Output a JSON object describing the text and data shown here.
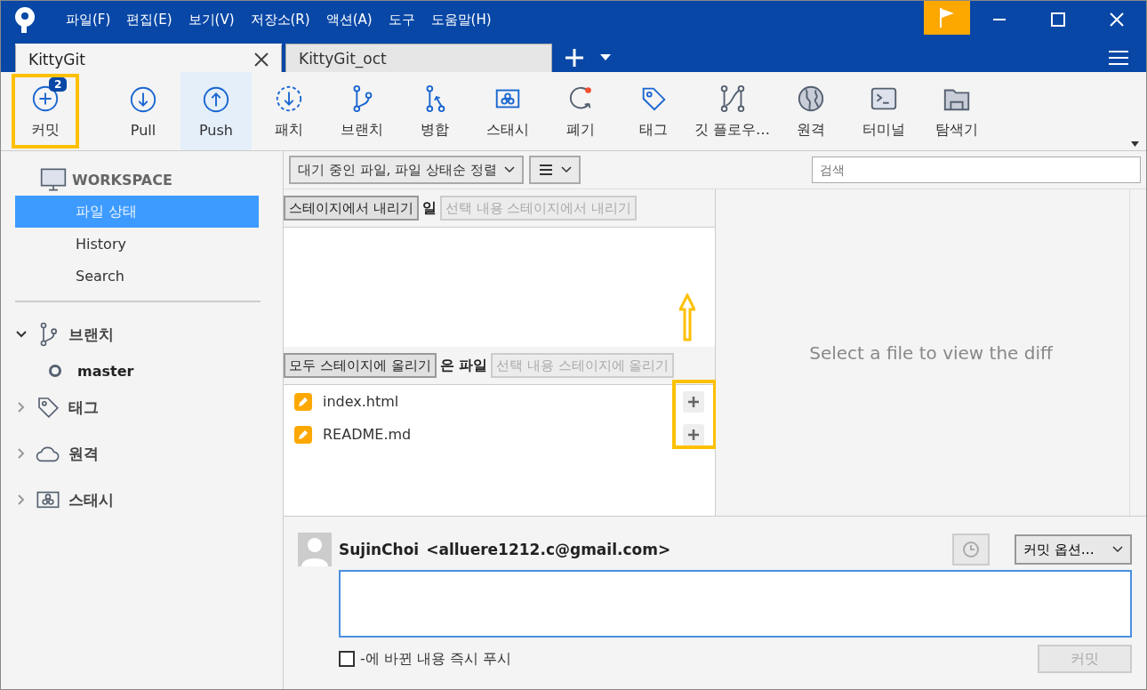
{
  "menu": [
    "파일(F)",
    "편집(E)",
    "보기(V)",
    "저장소(R)",
    "액션(A)",
    "도구",
    "도움말(H)"
  ],
  "tabs": [
    {
      "label": "KittyGit",
      "selected": true
    },
    {
      "label": "KittyGit_oct",
      "selected": false
    }
  ],
  "toolbar": [
    {
      "kind": "commit",
      "label": "커밋",
      "badge": "2",
      "selected": false,
      "highlighted": true
    },
    {
      "kind": "pull",
      "label": "Pull",
      "selected": false
    },
    {
      "kind": "push",
      "label": "Push",
      "selected": true
    },
    {
      "kind": "patch",
      "label": "패치",
      "selected": false
    },
    {
      "kind": "branch",
      "label": "브랜치",
      "selected": false
    },
    {
      "kind": "merge",
      "label": "병합",
      "selected": false
    },
    {
      "kind": "stash",
      "label": "스태시",
      "selected": false
    },
    {
      "kind": "discard",
      "label": "폐기",
      "selected": false
    },
    {
      "kind": "tag",
      "label": "태그",
      "selected": false
    },
    {
      "kind": "flow",
      "label": "깃 플로우…",
      "selected": false
    },
    {
      "kind": "remote",
      "label": "원격",
      "selected": false
    },
    {
      "kind": "terminal",
      "label": "터미널",
      "selected": false
    },
    {
      "kind": "explorer",
      "label": "탐색기",
      "selected": false
    }
  ],
  "sidebar": {
    "workspace": "WORKSPACE",
    "items": [
      {
        "label": "파일 상태",
        "selected": true
      },
      {
        "label": "History",
        "selected": false
      },
      {
        "label": "Search",
        "selected": false
      }
    ],
    "sections": [
      {
        "kind": "branch",
        "label": "브랜치",
        "expanded": true,
        "children": [
          {
            "label": "master",
            "current": true
          }
        ]
      },
      {
        "kind": "tag",
        "label": "태그",
        "expanded": false
      },
      {
        "kind": "remote",
        "label": "원격",
        "expanded": false
      },
      {
        "kind": "stash",
        "label": "스태시",
        "expanded": false
      }
    ]
  },
  "filter": {
    "sort": "대기 중인 파일, 파일 상태순 정렬",
    "search_placeholder": "검색"
  },
  "staged": {
    "button": "스테이지에서 내리기",
    "header": "일",
    "selected_button": "선택 내용 스테이지에서 내리기"
  },
  "unstaged": {
    "button": "모두 스테이지에 올리기",
    "header": "은 파일",
    "selected_button": "선택 내용 스테이지에 올리기",
    "files": [
      {
        "name": "index.html"
      },
      {
        "name": "README.md"
      }
    ]
  },
  "diff": {
    "message": "Select a file to view the diff"
  },
  "commit": {
    "author": "SujinChoi",
    "email": "<alluere1212.c@gmail.com>",
    "options": "커밋 옵션…",
    "push_label": "-에 바뀐 내용 즉시 푸시",
    "push_checked": false,
    "button": "커밋"
  }
}
